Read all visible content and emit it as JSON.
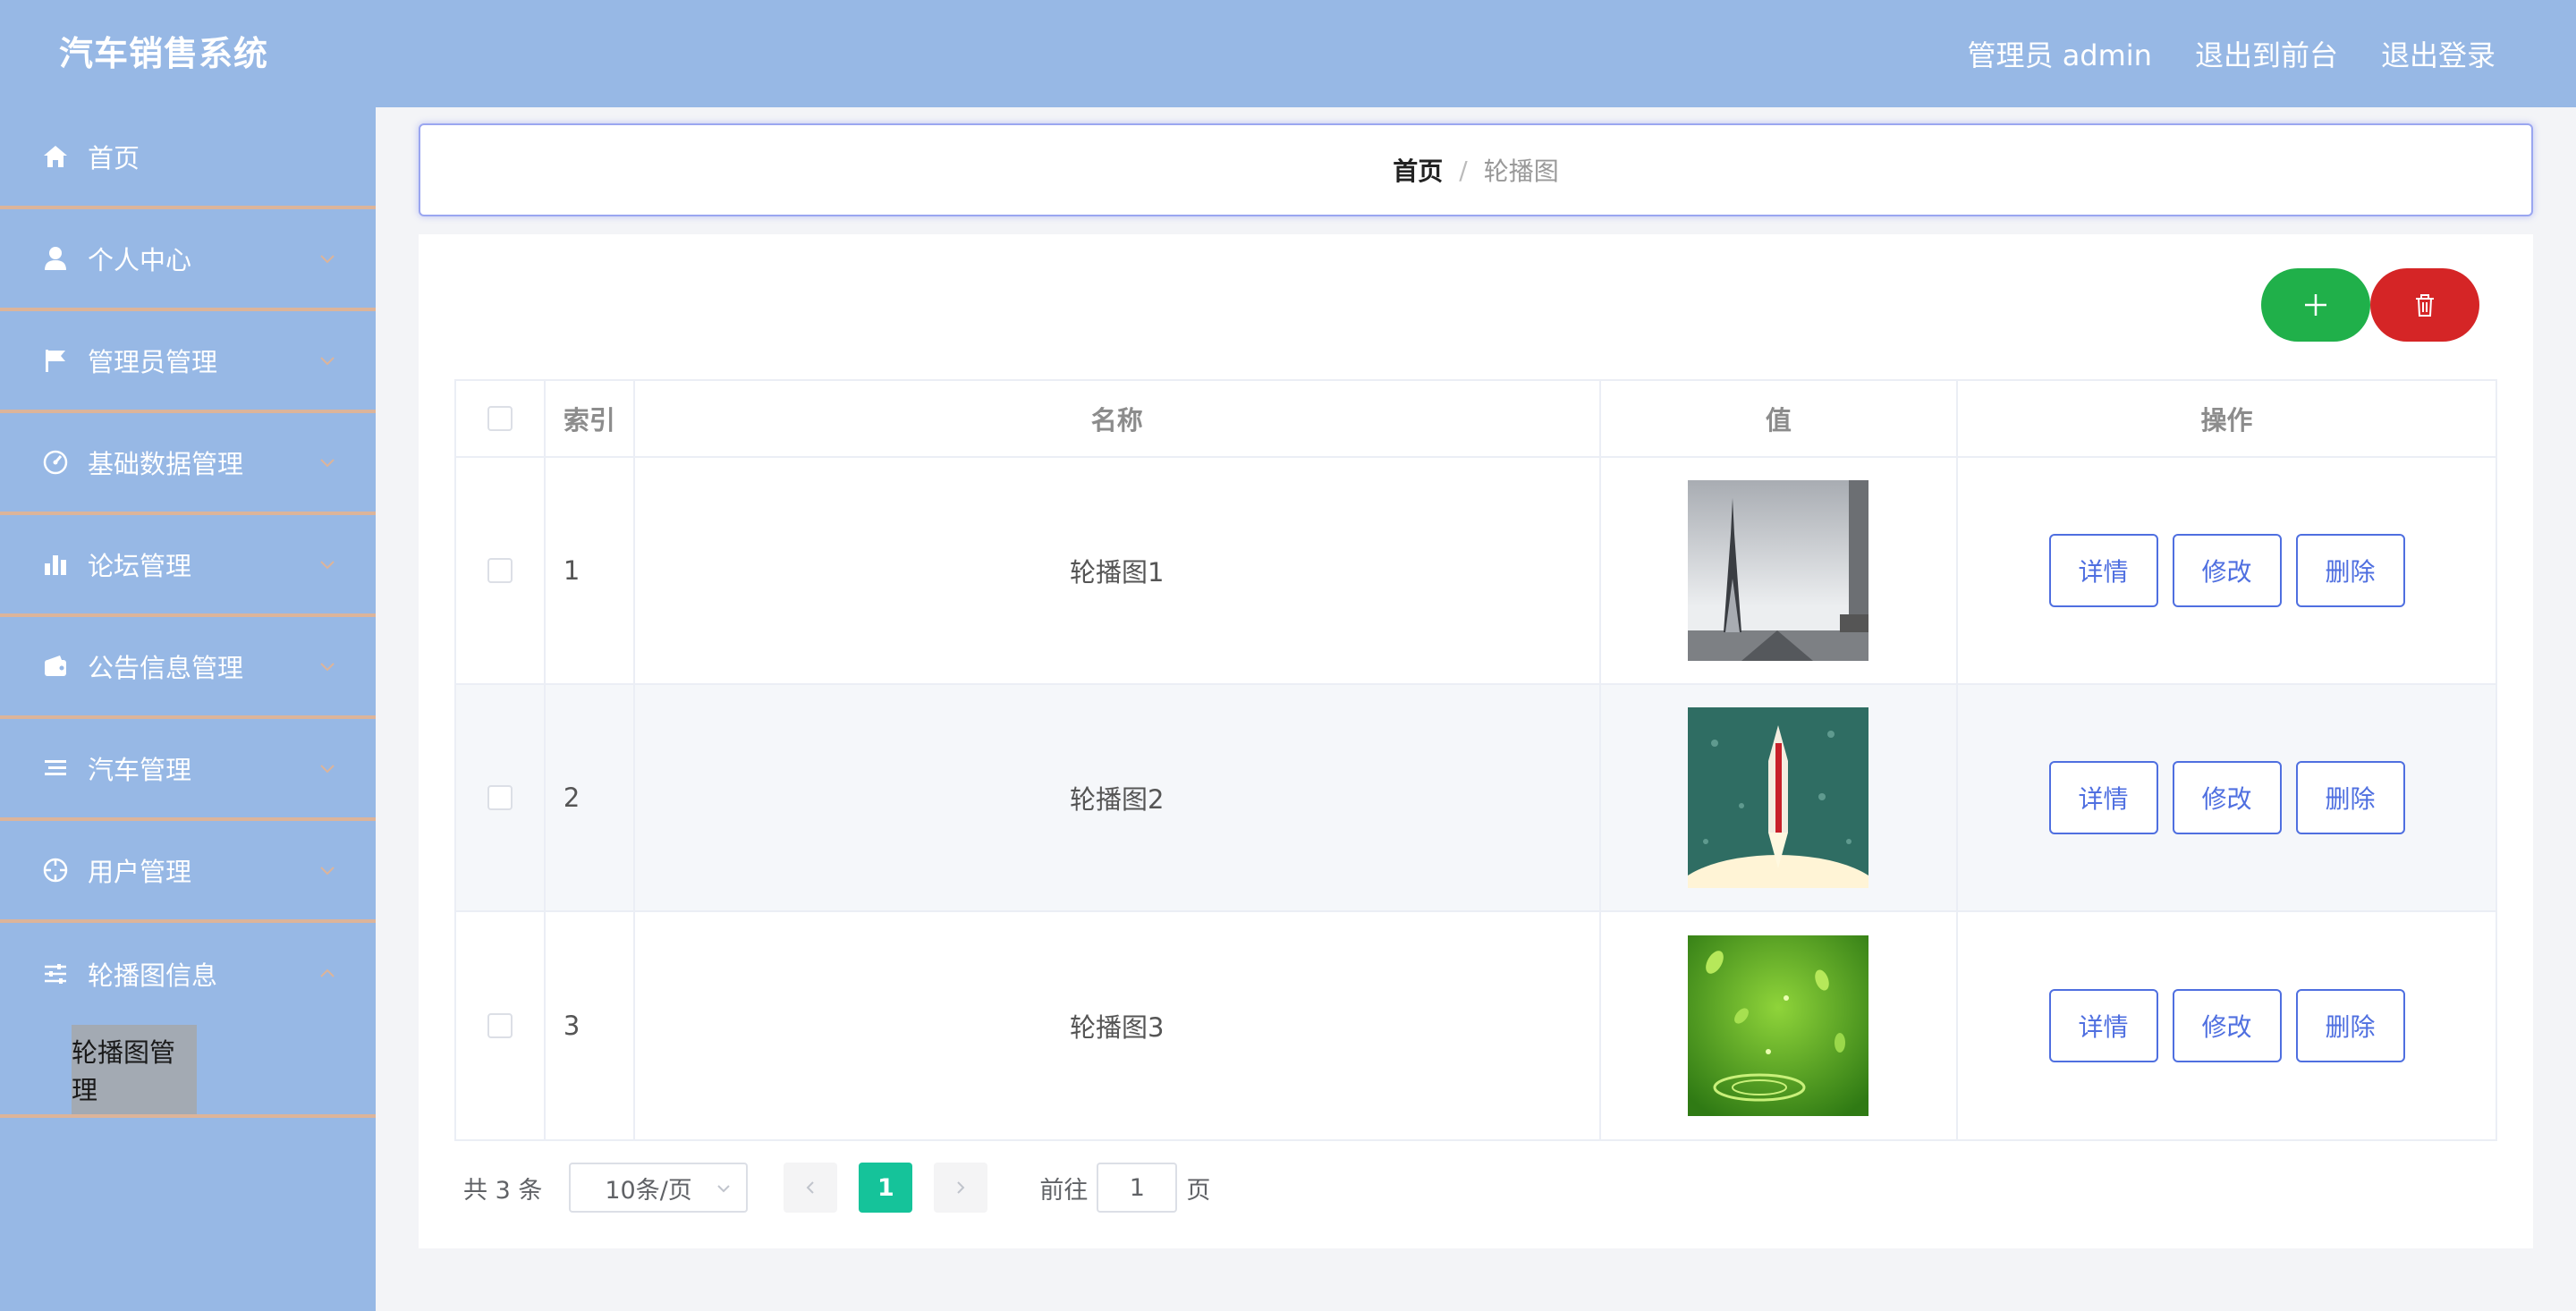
{
  "app": {
    "title": "汽车销售系统"
  },
  "header": {
    "user_label": "管理员 admin",
    "front_link": "退出到前台",
    "logout_link": "退出登录"
  },
  "sidebar": {
    "items": [
      {
        "label": "首页",
        "icon": "home-icon"
      },
      {
        "label": "个人中心",
        "icon": "user-icon"
      },
      {
        "label": "管理员管理",
        "icon": "flag-icon"
      },
      {
        "label": "基础数据管理",
        "icon": "gauge-icon"
      },
      {
        "label": "论坛管理",
        "icon": "bar-chart-icon"
      },
      {
        "label": "公告信息管理",
        "icon": "wallet-icon"
      },
      {
        "label": "汽车管理",
        "icon": "list-icon"
      },
      {
        "label": "用户管理",
        "icon": "crosshair-icon"
      },
      {
        "label": "轮播图信息",
        "icon": "sliders-icon"
      }
    ],
    "subitems": [
      {
        "label": "轮播图管理"
      }
    ]
  },
  "breadcrumb": {
    "home": "首页",
    "separator": "/",
    "current": "轮播图"
  },
  "toolbar": {
    "add_icon": "plus-icon",
    "delete_icon": "trash-icon"
  },
  "table": {
    "columns": [
      "索引",
      "名称",
      "值",
      "操作"
    ],
    "rows": [
      {
        "index": "1",
        "name": "轮播图1",
        "image": "eiffel-tower-thumbnail"
      },
      {
        "index": "2",
        "name": "轮播图2",
        "image": "teal-rocket-thumbnail"
      },
      {
        "index": "3",
        "name": "轮播图3",
        "image": "green-leaves-thumbnail"
      }
    ],
    "actions": {
      "detail": "详情",
      "edit": "修改",
      "delete": "删除"
    }
  },
  "pagination": {
    "total_text": "共 3 条",
    "page_size": "10条/页",
    "current_page": "1",
    "goto_label": "前往",
    "goto_value": "1",
    "page_suffix": "页"
  },
  "colors": {
    "header_bg": "#97b8e5",
    "sidebar_border": "#dcb49a",
    "add_button": "#20b04a",
    "delete_button": "#d52526",
    "action_button": "#4f6fe0",
    "active_page": "#15c39a"
  }
}
